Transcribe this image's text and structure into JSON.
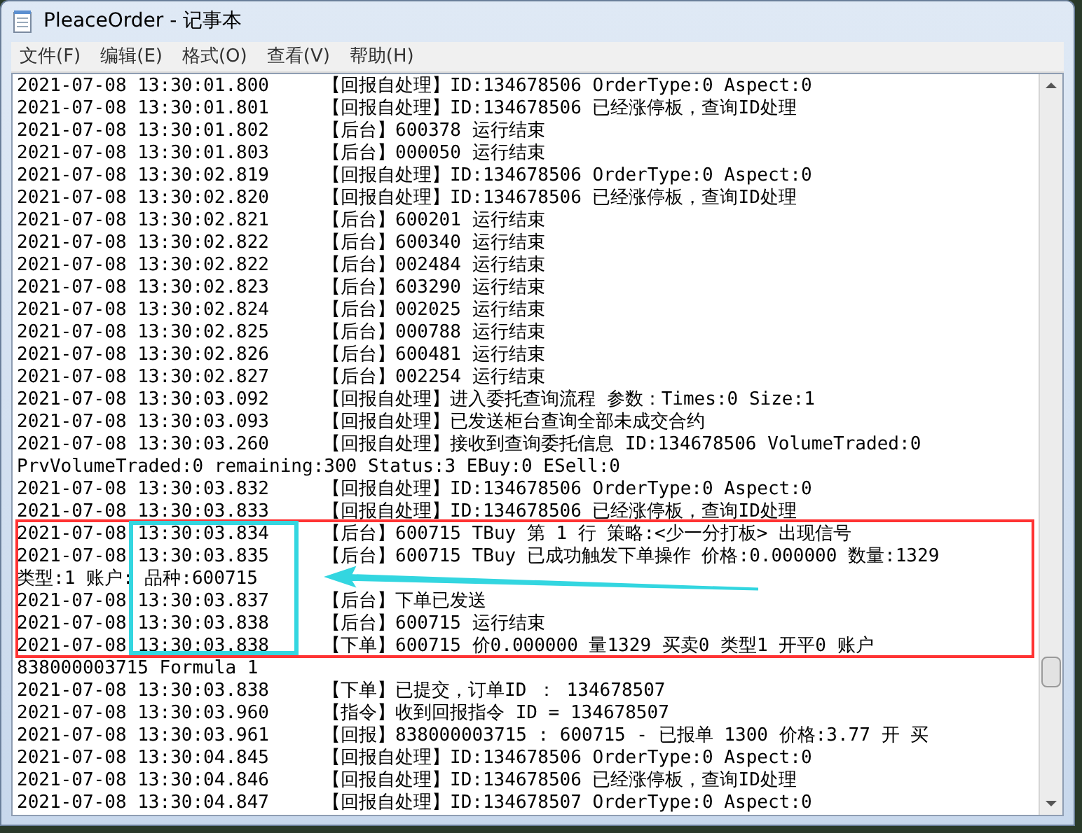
{
  "window": {
    "title": "PleaceOrder - 记事本"
  },
  "menu": [
    "文件(F)",
    "编辑(E)",
    "格式(O)",
    "查看(V)",
    "帮助(H)"
  ],
  "lines": [
    {
      "kind": "entry",
      "time": "2021-07-08 13:30:01.800",
      "message": "【回报自处理】ID:134678506 OrderType:0 Aspect:0"
    },
    {
      "kind": "entry",
      "time": "2021-07-08 13:30:01.801",
      "message": "【回报自处理】ID:134678506 已经涨停板，查询ID处理"
    },
    {
      "kind": "entry",
      "time": "2021-07-08 13:30:01.802",
      "message": "【后台】600378 运行结束"
    },
    {
      "kind": "entry",
      "time": "2021-07-08 13:30:01.803",
      "message": "【后台】000050 运行结束"
    },
    {
      "kind": "entry",
      "time": "2021-07-08 13:30:02.819",
      "message": "【回报自处理】ID:134678506 OrderType:0 Aspect:0"
    },
    {
      "kind": "entry",
      "time": "2021-07-08 13:30:02.820",
      "message": "【回报自处理】ID:134678506 已经涨停板，查询ID处理"
    },
    {
      "kind": "entry",
      "time": "2021-07-08 13:30:02.821",
      "message": "【后台】600201 运行结束"
    },
    {
      "kind": "entry",
      "time": "2021-07-08 13:30:02.822",
      "message": "【后台】600340 运行结束"
    },
    {
      "kind": "entry",
      "time": "2021-07-08 13:30:02.822",
      "message": "【后台】002484 运行结束"
    },
    {
      "kind": "entry",
      "time": "2021-07-08 13:30:02.823",
      "message": "【后台】603290 运行结束"
    },
    {
      "kind": "entry",
      "time": "2021-07-08 13:30:02.824",
      "message": "【后台】002025 运行结束"
    },
    {
      "kind": "entry",
      "time": "2021-07-08 13:30:02.825",
      "message": "【后台】000788 运行结束"
    },
    {
      "kind": "entry",
      "time": "2021-07-08 13:30:02.826",
      "message": "【后台】600481 运行结束"
    },
    {
      "kind": "entry",
      "time": "2021-07-08 13:30:02.827",
      "message": "【后台】002254 运行结束"
    },
    {
      "kind": "entry",
      "time": "2021-07-08 13:30:03.092",
      "message": "【回报自处理】进入委托查询流程 参数：Times:0 Size:1"
    },
    {
      "kind": "entry",
      "time": "2021-07-08 13:30:03.093",
      "message": "【回报自处理】已发送柜台查询全部未成交合约"
    },
    {
      "kind": "entry",
      "time": "2021-07-08 13:30:03.260",
      "message": "【回报自处理】接收到查询委托信息 ID:134678506 VolumeTraded:0"
    },
    {
      "kind": "continuation",
      "text": "PrvVolumeTraded:0 remaining:300 Status:3 EBuy:0 ESell:0"
    },
    {
      "kind": "entry",
      "time": "2021-07-08 13:30:03.832",
      "message": "【回报自处理】ID:134678506 OrderType:0 Aspect:0"
    },
    {
      "kind": "entry",
      "time": "2021-07-08 13:30:03.833",
      "message": "【回报自处理】ID:134678506 已经涨停板，查询ID处理"
    },
    {
      "kind": "entry",
      "time": "2021-07-08 13:30:03.834",
      "message": "【后台】600715 TBuy 第 1 行 策略:<少一分打板> 出现信号"
    },
    {
      "kind": "entry",
      "time": "2021-07-08 13:30:03.835",
      "message": "【后台】600715 TBuy 已成功触发下单操作 价格:0.000000 数量:1329"
    },
    {
      "kind": "continuation",
      "text": "类型:1 账户: 品种:600715"
    },
    {
      "kind": "entry",
      "time": "2021-07-08 13:30:03.837",
      "message": "【后台】下单已发送"
    },
    {
      "kind": "entry",
      "time": "2021-07-08 13:30:03.838",
      "message": "【后台】600715 运行结束"
    },
    {
      "kind": "entry",
      "time": "2021-07-08 13:30:03.838",
      "message": "【下单】600715 价0.000000 量1329 买卖0 类型1 开平0 账户"
    },
    {
      "kind": "continuation",
      "text": "838000003715 Formula 1"
    },
    {
      "kind": "entry",
      "time": "2021-07-08 13:30:03.838",
      "message": "【下单】已提交，订单ID ： 134678507"
    },
    {
      "kind": "entry",
      "time": "2021-07-08 13:30:03.960",
      "message": "【指令】收到回报指令 ID = 134678507"
    },
    {
      "kind": "entry",
      "time": "2021-07-08 13:30:03.961",
      "message": "【回报】838000003715 : 600715 - 已报单 1300 价格:3.77 开 买"
    },
    {
      "kind": "entry",
      "time": "2021-07-08 13:30:04.845",
      "message": "【回报自处理】ID:134678506 OrderType:0 Aspect:0"
    },
    {
      "kind": "entry",
      "time": "2021-07-08 13:30:04.846",
      "message": "【回报自处理】ID:134678506 已经涨停板，查询ID处理"
    },
    {
      "kind": "entry",
      "time": "2021-07-08 13:30:04.847",
      "message": "【回报自处理】ID:134678507 OrderType:0 Aspect:0"
    }
  ]
}
